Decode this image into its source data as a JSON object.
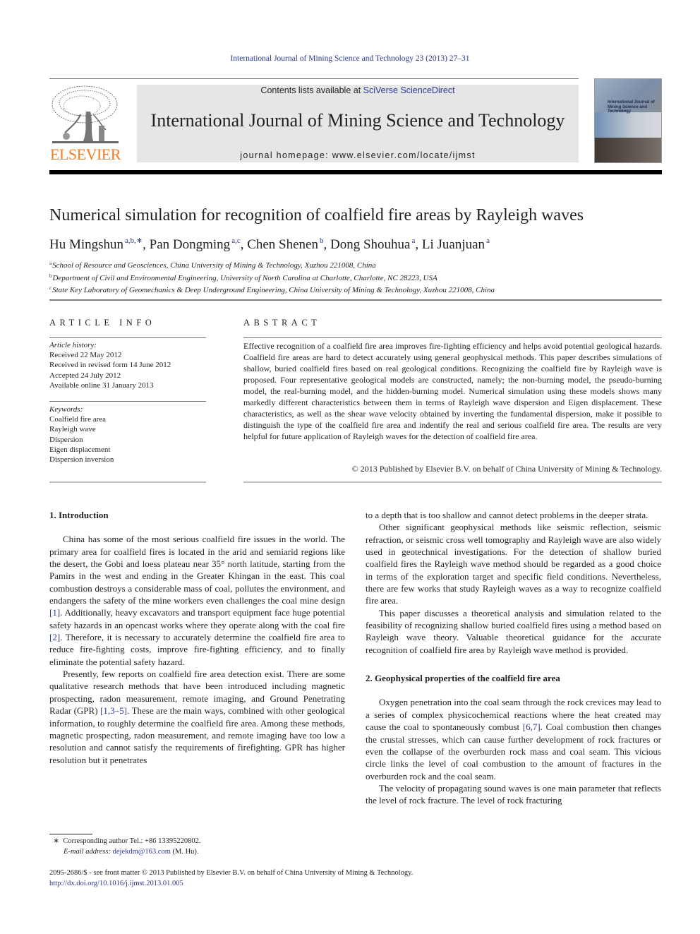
{
  "running_head": "International Journal of Mining Science and Technology 23 (2013) 27–31",
  "masthead": {
    "publisher_logo_text": "ELSEVIER",
    "contents_prefix": "Contents lists available at ",
    "contents_link": "SciVerse ScienceDirect",
    "journal_title": "International Journal of Mining Science and Technology",
    "homepage_prefix": "journal homepage: ",
    "homepage_url": "www.elsevier.com/locate/ijmst",
    "cover_title": "International Journal of Mining Science and Technology"
  },
  "article": {
    "title": "Numerical simulation for recognition of coalfield fire areas by Rayleigh waves",
    "authors": [
      {
        "name": "Hu Mingshun",
        "affil": "a,b,∗",
        "sep": ", "
      },
      {
        "name": "Pan Dongming",
        "affil": "a,c",
        "sep": ", "
      },
      {
        "name": "Chen Shenen",
        "affil": "b",
        "sep": ", "
      },
      {
        "name": "Dong Shouhua",
        "affil": "a",
        "sep": ", "
      },
      {
        "name": "Li Juanjuan",
        "affil": "a",
        "sep": ""
      }
    ],
    "affiliations": [
      {
        "mark": "a",
        "text": "School of Resource and Geosciences, China University of Mining & Technology, Xuzhou 221008, China"
      },
      {
        "mark": "b",
        "text": "Department of Civil and Environmental Engineering, University of North Carolina at Charlotte, Charlotte, NC 28223, USA"
      },
      {
        "mark": "c",
        "text": "State Key Laboratory of Geomechanics & Deep Underground Engineering, China University of Mining & Technology, Xuzhou 221008, China"
      }
    ]
  },
  "article_info": {
    "heading": "ARTICLE INFO",
    "history_label": "Article history:",
    "history": [
      "Received 22 May 2012",
      "Received in revised form 14 June 2012",
      "Accepted 24 July 2012",
      "Available online 31 January 2013"
    ],
    "keywords_label": "Keywords:",
    "keywords": [
      "Coalfield fire area",
      "Rayleigh wave",
      "Dispersion",
      "Eigen displacement",
      "Dispersion inversion"
    ]
  },
  "abstract": {
    "heading": "ABSTRACT",
    "text": "Effective recognition of a coalfield fire area improves fire-fighting efficiency and helps avoid potential geological hazards. Coalfield fire areas are hard to detect accurately using general geophysical methods. This paper describes simulations of shallow, buried coalfield fires based on real geological conditions. Recognizing the coalfield fire by Rayleigh wave is proposed. Four representative geological models are constructed, namely; the non-burning model, the pseudo-burning model, the real-burning model, and the hidden-burning model. Numerical simulation using these models shows many markedly different characteristics between them in terms of Rayleigh wave dispersion and Eigen displacement. These characteristics, as well as the shear wave velocity obtained by inverting the fundamental dispersion, make it possible to distinguish the type of the coalfield fire area and indentify the real and serious coalfield fire area. The results are very helpful for future application of Rayleigh waves for the detection of coalfield fire area.",
    "copyright": "© 2013 Published by Elsevier B.V. on behalf of China University of Mining & Technology."
  },
  "body": {
    "section1_heading": "1. Introduction",
    "s1p1": [
      {
        "t": "China has some of the most serious coalfield fire issues in the world. The primary area for coalfield fires is located in the arid and semiarid regions like the desert, the Gobi and loess plateau near 35° north latitude, starting from the Pamirs in the west and ending in the Greater Khingan in the east. This coal combustion destroys a considerable mass of coal, pollutes the environment, and endangers the safety of the mine workers even challenges the coal mine design "
      },
      {
        "ref": "[1]"
      },
      {
        "t": ". Additionally, heavy excavators and transport equipment face huge potential safety hazards in an opencast works where they operate along with the coal fire "
      },
      {
        "ref": "[2]"
      },
      {
        "t": ". Therefore, it is necessary to accurately determine the coalfield fire area to reduce fire-fighting costs, improve fire-fighting efficiency, and to finally eliminate the potential safety hazard."
      }
    ],
    "s1p2": [
      {
        "t": "Presently, few reports on coalfield fire area detection exist. There are some qualitative research methods that have been introduced including magnetic prospecting, radon measurement, remote imaging, and Ground Penetrating Radar (GPR) "
      },
      {
        "ref": "[1,3–5]"
      },
      {
        "t": ". These are the main ways, combined with other geological information, to roughly determine the coalfield fire area. Among these methods, magnetic prospecting, radon measurement, and remote imaging have too low a resolution and cannot satisfy the requirements of firefighting. GPR has higher resolution but it penetrates"
      }
    ],
    "s1p2_cont": "to a depth that is too shallow and cannot detect problems in the deeper strata.",
    "s1p3": "Other significant geophysical methods like seismic reflection, seismic refraction, or seismic cross well tomography and Rayleigh wave are also widely used in geotechnical investigations. For the detection of shallow buried coalfield fires the Rayleigh wave method should be regarded as a good choice in terms of the exploration target and specific field conditions. Nevertheless, there are few works that study Rayleigh waves as a way to recognize coalfield fire area.",
    "s1p4": "This paper discusses a theoretical analysis and simulation related to the feasibility of recognizing shallow buried coalfield fires using a method based on Rayleigh wave theory. Valuable theoretical guidance for the accurate recognition of coalfield fire area by Rayleigh wave method is provided.",
    "section2_heading": "2. Geophysical properties of the coalfield fire area",
    "s2p1": [
      {
        "t": "Oxygen penetration into the coal seam through the rock crevices may lead to a series of complex physicochemical reactions where the heat created may cause the coal to spontaneously combust "
      },
      {
        "ref": "[6,7]"
      },
      {
        "t": ". Coal combustion then changes the crustal stresses, which can cause further development of rock fractures or even the collapse of the overburden rock mass and coal seam. This vicious circle links the level of coal combustion to the amount of fractures in the overburden rock and the coal seam."
      }
    ],
    "s2p2": "The velocity of propagating sound waves is one main parameter that reflects the level of rock fracture. The level of rock fracturing"
  },
  "footnote": {
    "mark": "∗",
    "corresponding": "Corresponding author Tel.: +86 13395220802.",
    "email_label": "E-mail address:",
    "email": "dejekdm@163.com",
    "email_suffix": " (M. Hu)."
  },
  "footer": {
    "issn_line": "2095-2686/$ - see front matter © 2013 Published by Elsevier B.V. on behalf of China University of Mining & Technology.",
    "doi": "http://dx.doi.org/10.1016/j.ijmst.2013.01.005"
  }
}
